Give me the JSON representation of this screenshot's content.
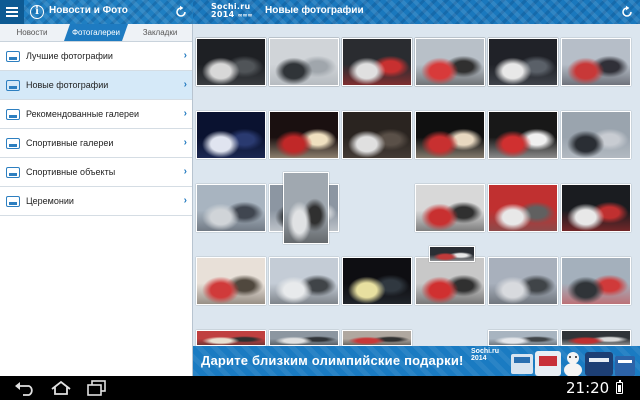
{
  "header": {
    "app_title": "Новости и Фото",
    "page_title": "Новые фотографии",
    "logo_line1": "Sochi.ru",
    "logo_line2": "2014"
  },
  "sidebar": {
    "tabs": [
      {
        "label": "Новости",
        "active": false
      },
      {
        "label": "Фотогалереи",
        "active": true
      },
      {
        "label": "Закладки",
        "active": false
      }
    ],
    "items": [
      {
        "label": "Лучшие фотографии",
        "icon": "image-icon",
        "active": false
      },
      {
        "label": "Новые фотографии",
        "icon": "image-icon",
        "active": true
      },
      {
        "label": "Рекомендованные галереи",
        "icon": "gallery-icon",
        "active": false
      },
      {
        "label": "Спортивные галереи",
        "icon": "gallery-icon",
        "active": false
      },
      {
        "label": "Спортивные объекты",
        "icon": "venue-icon",
        "active": false
      },
      {
        "label": "Церемонии",
        "icon": "ceremony-icon",
        "active": false
      }
    ]
  },
  "photos": [
    {
      "colors": [
        "#8a9cb0",
        "#e8e8e8",
        "#3c3c40"
      ]
    },
    {
      "colors": [
        "#c4ccd4",
        "#d83a3a",
        "#2a2a30"
      ]
    },
    {
      "colors": [
        "#e6e8ea",
        "#b0b4bc",
        "#404048"
      ]
    },
    {
      "colors": [
        "#c9d4e0",
        "#5a5e66",
        "#d04040"
      ]
    },
    {
      "colors": [
        "#9aa6b4",
        "#d43c3c",
        "#e8e8e8"
      ]
    },
    {
      "colors": [
        "#b6bec8",
        "#c83838",
        "#303038"
      ]
    },
    {
      "colors": [
        "#0a1230",
        "#e0e4f0",
        "#2a3a70"
      ]
    },
    {
      "colors": [
        "#1a1010",
        "#c02828",
        "#f0e0c0"
      ]
    },
    {
      "colors": [
        "#2a2420",
        "#e0e0e0",
        "#5a5048"
      ]
    },
    {
      "colors": [
        "#101010",
        "#c83030",
        "#e8d8c0"
      ]
    },
    {
      "colors": [
        "#181818",
        "#d03030",
        "#f0f0f0"
      ]
    },
    {
      "colors": [
        "#9aa4ae",
        "#2a2e34",
        "#c8ccd2"
      ]
    },
    {
      "colors": [
        "#a8b4c0",
        "#d0d4d8",
        "#404650"
      ]
    },
    {
      "colors": [
        "#8c96a2",
        "#303438",
        "#e8eaec"
      ]
    },
    {
      "colors": [
        "#a0a8b0",
        "#e0e2e4",
        "#303030"
      ]
    },
    {
      "colors": [
        "#d8d8d8",
        "#c83030",
        "#303030"
      ]
    },
    {
      "colors": [
        "#c03030",
        "#e8e8e8",
        "#606060"
      ]
    },
    {
      "colors": [
        "#1a1c20",
        "#e8e8e8",
        "#c03030"
      ]
    },
    {
      "colors": [
        "#e8e0d8",
        "#d03a3a",
        "#50483e"
      ]
    },
    {
      "colors": [
        "#c4ccd6",
        "#e8eaec",
        "#404448"
      ]
    },
    {
      "colors": [
        "#0e0e12",
        "#e8e0a0",
        "#303840"
      ]
    },
    {
      "colors": [
        "#c8c8c8",
        "#d03030",
        "#303030"
      ]
    },
    {
      "colors": [
        "#a8b0bc",
        "#d8dade",
        "#404448"
      ]
    },
    {
      "colors": [
        "#a4b0bc",
        "#303438",
        "#d03a3a"
      ]
    },
    {
      "colors": [
        "#c04040",
        "#e8e0d0",
        "#303030"
      ]
    },
    {
      "colors": [
        "#8c96a0",
        "#e0e0e0",
        "#303438"
      ]
    },
    {
      "colors": [
        "#b0a8a0",
        "#c83838",
        "#303030"
      ]
    },
    {
      "colors": [
        "#2a2e34",
        "#c03a3a",
        "#e8e8e8"
      ]
    },
    {
      "colors": [
        "#a8b4c0",
        "#e4e6ea",
        "#404448"
      ]
    },
    {
      "colors": [
        "#303438",
        "#c03030",
        "#d8d8d8"
      ]
    },
    {
      "colors": [
        "#1e2024",
        "#d8d8d8",
        "#505458"
      ]
    },
    {
      "colors": [
        "#d0d4d8",
        "#303438",
        "#a0a6ac"
      ]
    },
    {
      "colors": [
        "#2a2c30",
        "#e0e0e0",
        "#c83030"
      ]
    },
    {
      "colors": [
        "#b8c0c8",
        "#d83a3a",
        "#303030"
      ]
    },
    {
      "colors": [
        "#202228",
        "#e8e8e8",
        "#5a6068"
      ]
    }
  ],
  "banner": {
    "text": "Дарите близким олимпийские подарки!",
    "logo_line1": "Sochi.ru",
    "logo_line2": "2014"
  },
  "system_bar": {
    "time": "21:20"
  },
  "colors": {
    "accent": "#1e7bc1",
    "sidebar_active": "#d5e9f8",
    "grid_bg": "#dce6ef"
  }
}
